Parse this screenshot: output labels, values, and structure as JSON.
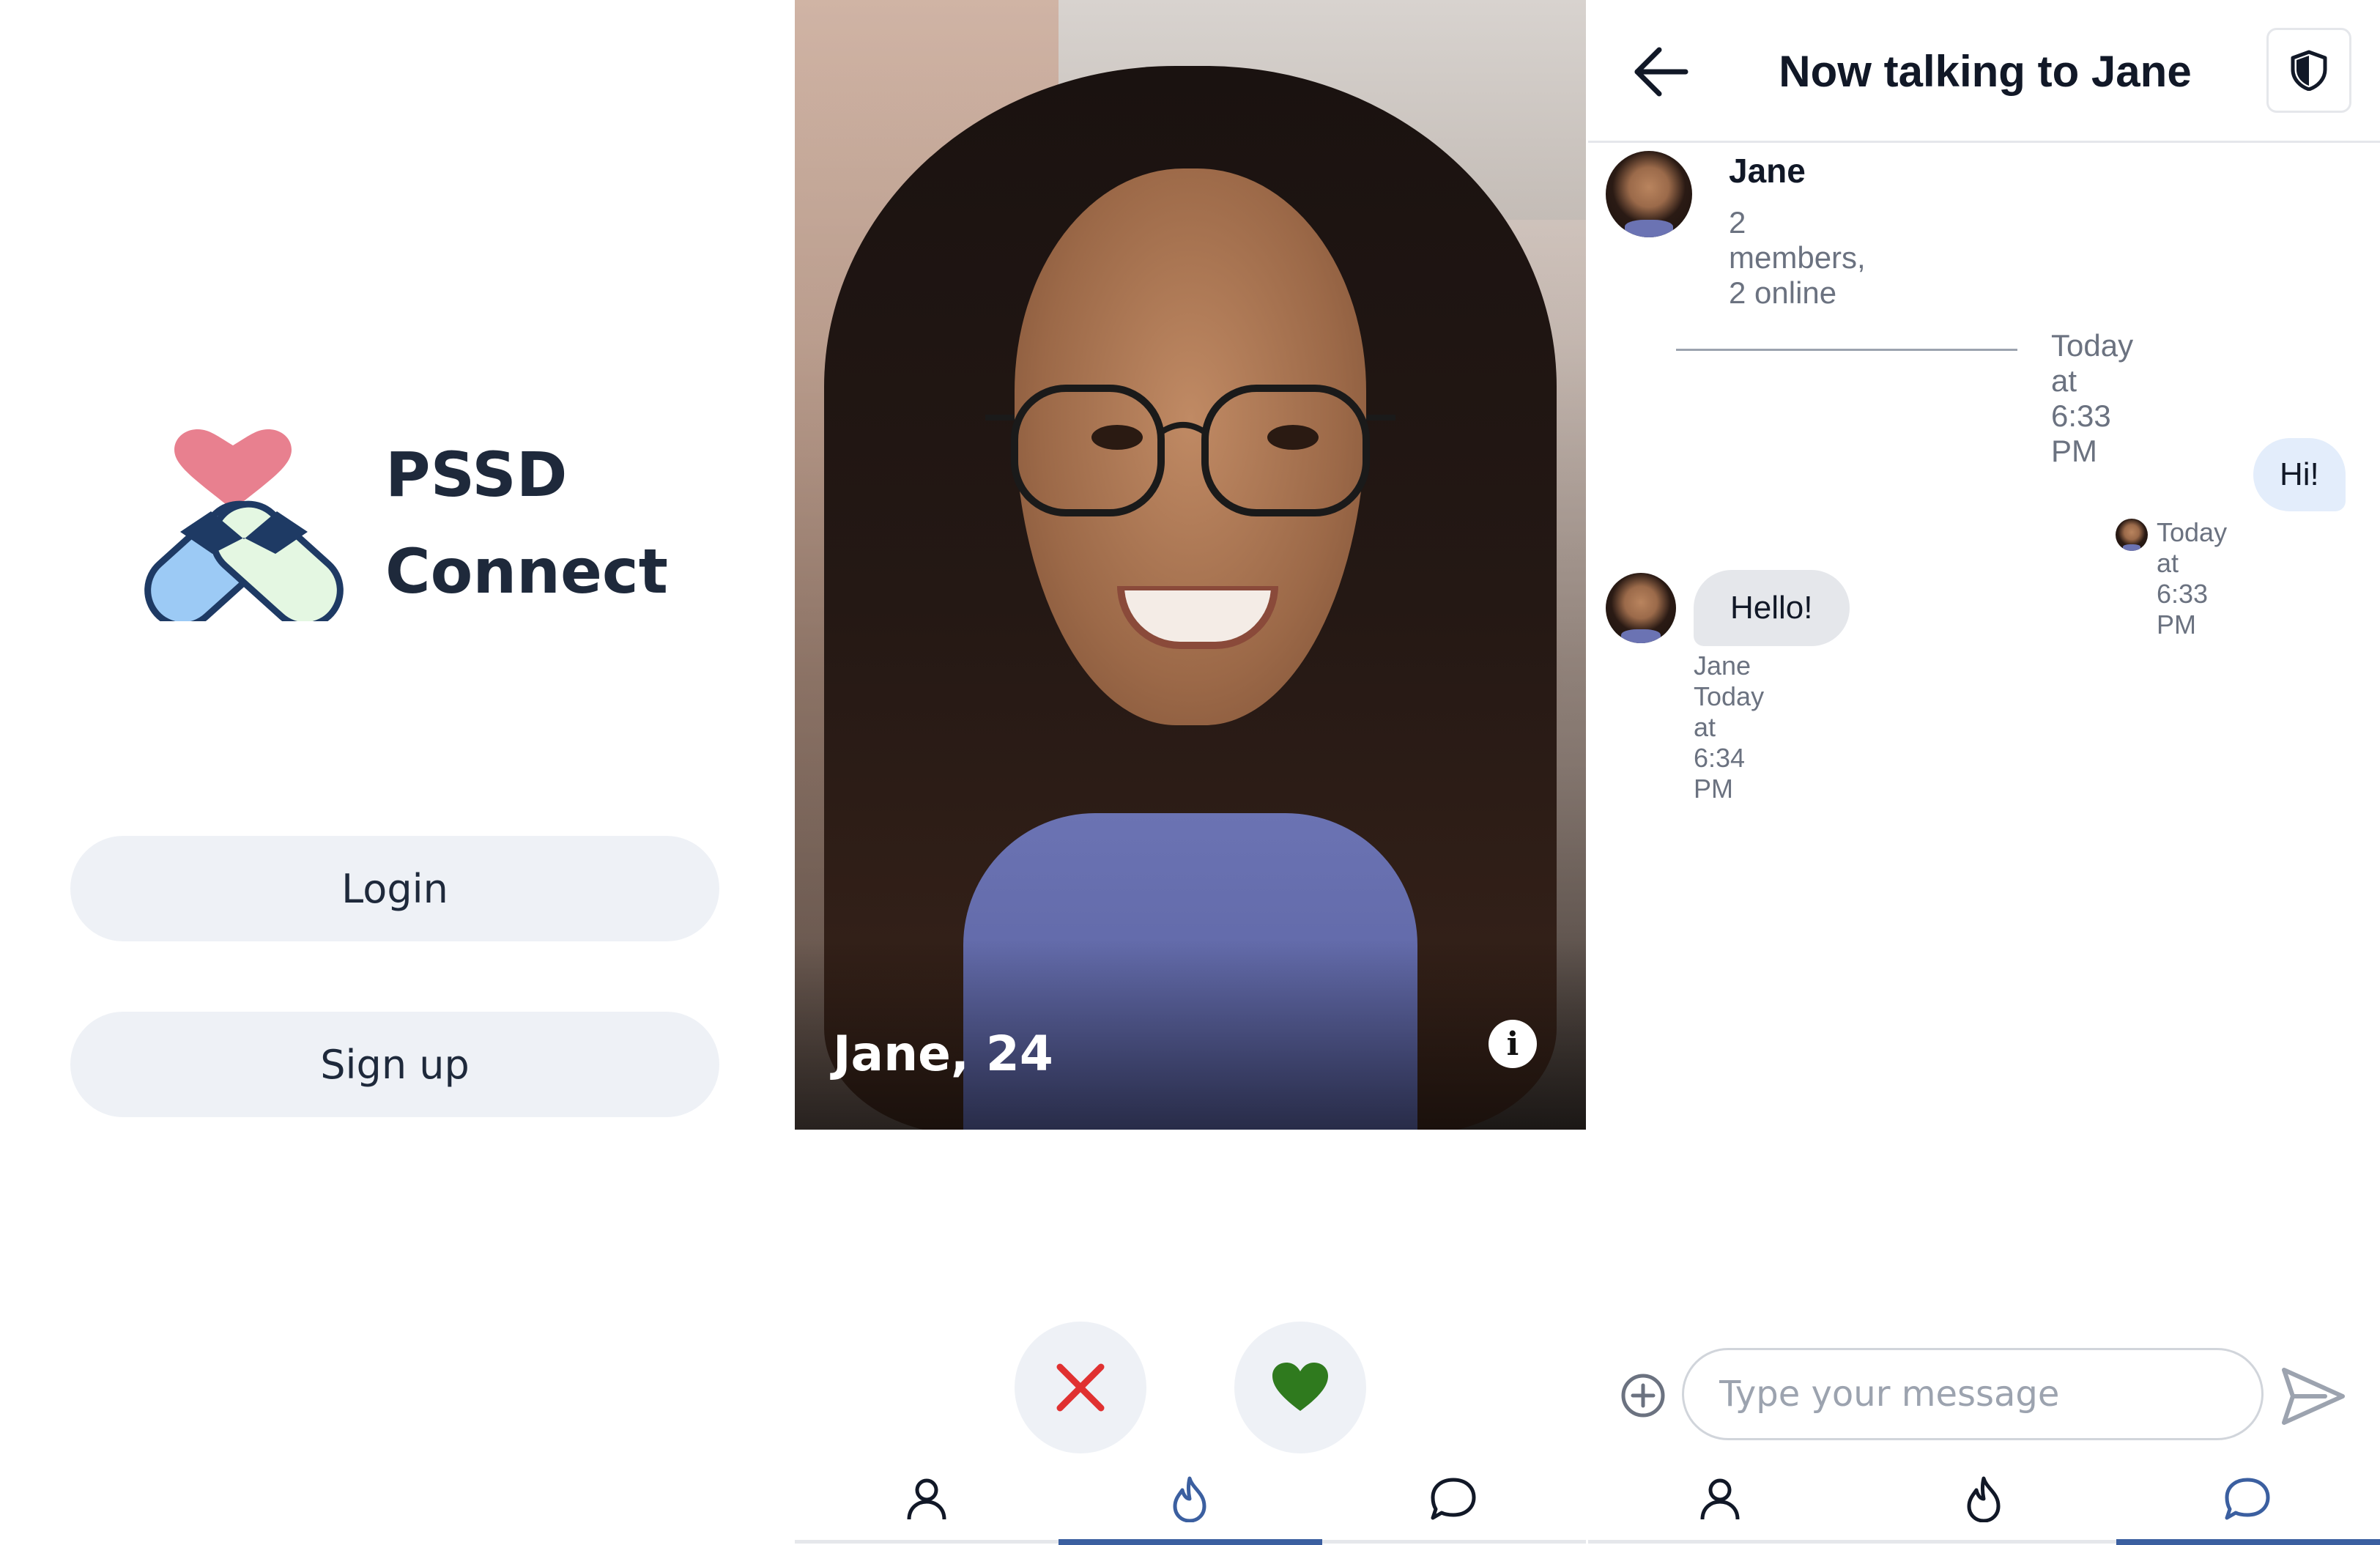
{
  "landing": {
    "brand_line1": "PSSD",
    "brand_line2": "Connect",
    "login_label": "Login",
    "signup_label": "Sign up",
    "logo_icon": "heart-capsules-logo",
    "colors": {
      "heart": "#e8808f",
      "capsule_left": "#9ccaf5",
      "capsule_right": "#e4f7e2",
      "outline": "#1e3a64"
    }
  },
  "profile_card": {
    "name_age": "Jane, 24",
    "info_icon_text": "i",
    "reject_icon": "x-icon",
    "like_icon": "heart-icon",
    "colors": {
      "reject": "#e03131",
      "like": "#2f7a1e"
    }
  },
  "nav_matching": {
    "items": [
      {
        "icon": "user-icon",
        "active": false
      },
      {
        "icon": "flame-icon",
        "active": true
      },
      {
        "icon": "chat-bubble-icon",
        "active": false
      }
    ],
    "active_color": "#3b5fa0"
  },
  "chat": {
    "title": "Now talking to Jane",
    "back_icon": "arrow-left-icon",
    "shield_icon": "shield-icon",
    "channel": {
      "name": "Jane",
      "subtitle": "2 members, 2 online"
    },
    "date_separator": "Today at 6:33 PM",
    "messages": [
      {
        "direction": "outgoing",
        "text": "Hi!",
        "meta": "Today at 6:33 PM"
      },
      {
        "direction": "incoming",
        "text": "Hello!",
        "meta": "Jane Today at 6:34 PM"
      }
    ],
    "input": {
      "placeholder": "Type your message",
      "value": ""
    },
    "add_icon": "plus-circle-icon",
    "send_icon": "send-icon"
  },
  "nav_chat": {
    "items": [
      {
        "icon": "user-icon",
        "active": false
      },
      {
        "icon": "flame-icon",
        "active": false
      },
      {
        "icon": "chat-bubble-icon",
        "active": true
      }
    ],
    "active_color": "#3b5fa0"
  }
}
